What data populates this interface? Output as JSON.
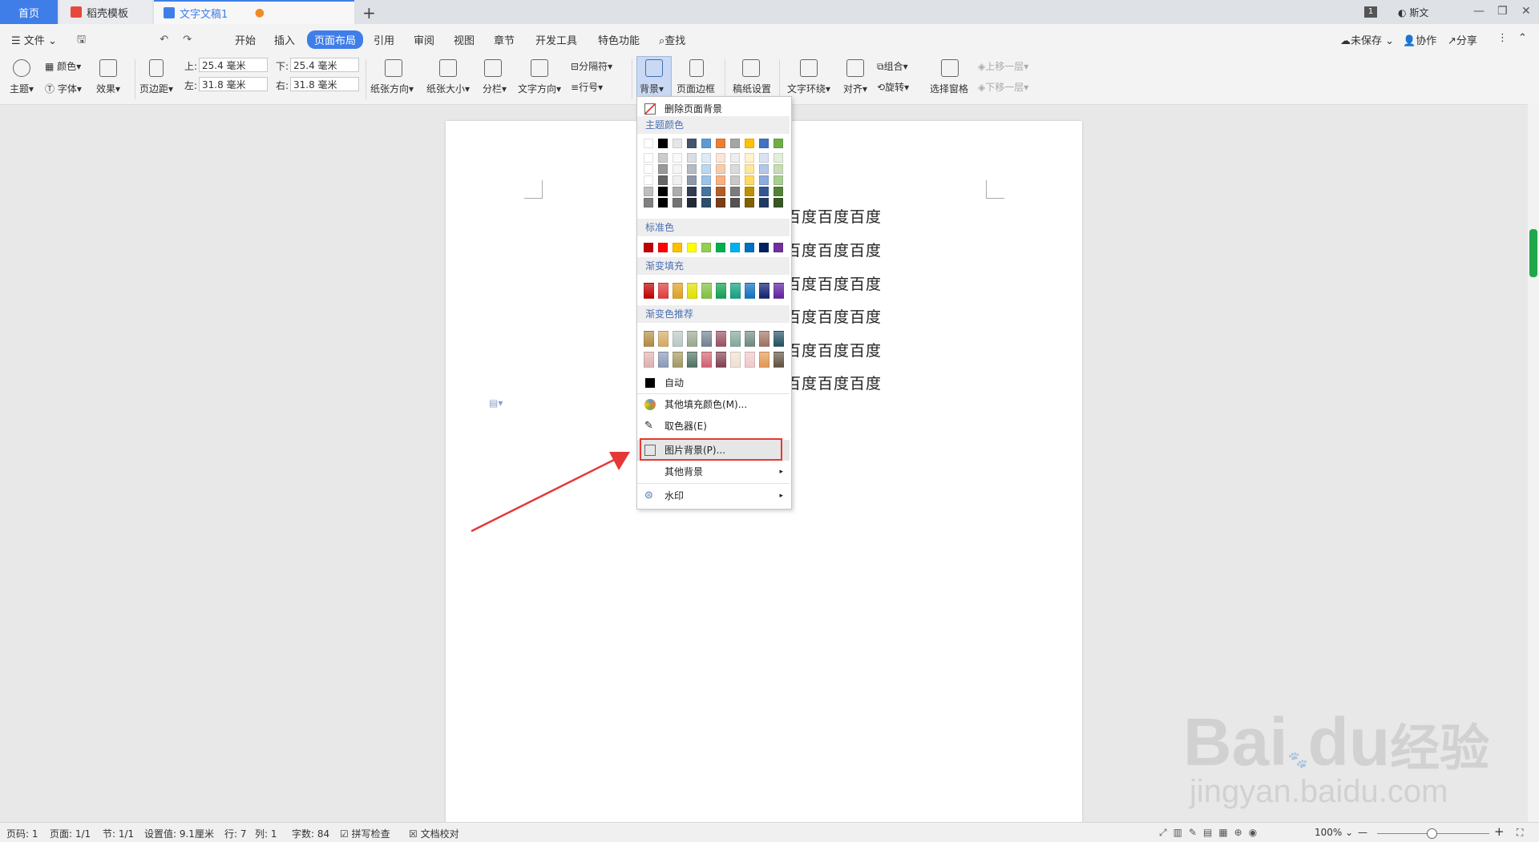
{
  "tabs": {
    "home": "首页",
    "daoke": "稻壳模板",
    "doc": "文字文稿1"
  },
  "window": {
    "page_badge": "1",
    "user": "斯文"
  },
  "menu": {
    "file": "文件",
    "items": [
      "开始",
      "插入",
      "页面布局",
      "引用",
      "审阅",
      "视图",
      "章节",
      "开发工具",
      "特色功能"
    ],
    "search": "查找",
    "unsaved": "未保存",
    "collab": "协作",
    "share": "分享"
  },
  "ribbon": {
    "theme": "主题",
    "color": "颜色",
    "font": "字体",
    "effect": "效果",
    "margins": "页边距",
    "top_label": "上:",
    "top_value": "25.4 毫米",
    "bottom_label": "下:",
    "bottom_value": "25.4 毫米",
    "left_label": "左:",
    "left_value": "31.8 毫米",
    "right_label": "右:",
    "right_value": "31.8 毫米",
    "orientation": "纸张方向",
    "size": "纸张大小",
    "columns": "分栏",
    "text_dir": "文字方向",
    "breaks": "分隔符",
    "line_num": "行号",
    "background": "背景",
    "border": "页面边框",
    "manuscript": "稿纸设置",
    "wrap": "文字环绕",
    "align": "对齐",
    "group": "组合",
    "rotate": "旋转",
    "select_pane": "选择窗格",
    "bring_forward": "上移一层",
    "send_backward": "下移一层"
  },
  "document": {
    "lines": [
      "百度百度百度",
      "百度百度百度",
      "百度百度百度",
      "百度百度百度",
      "百度百度百度",
      "百度百度百度"
    ]
  },
  "dropdown": {
    "remove_bg": "删除页面背景",
    "theme_colors": "主题颜色",
    "standard_colors": "标准色",
    "gradient_fill": "渐变填充",
    "gradient_recommend": "渐变色推荐",
    "auto": "自动",
    "more_colors": "其他填充颜色(M)...",
    "eyedropper": "取色器(E)",
    "picture_bg": "图片背景(P)...",
    "other_bg": "其他背景",
    "watermark": "水印",
    "theme_row": [
      "#ffffff",
      "#000000",
      "#e7e6e6",
      "#44546a",
      "#5b9bd5",
      "#ed7d31",
      "#a5a5a5",
      "#ffc000",
      "#4472c4",
      "#70ad47"
    ],
    "standard_row": [
      "#c00000",
      "#ff0000",
      "#ffc000",
      "#ffff00",
      "#92d050",
      "#00b050",
      "#00b0f0",
      "#0070c0",
      "#002060",
      "#7030a0"
    ],
    "gradient_row": [
      "#c00000",
      "#e03a3a",
      "#e0a020",
      "#e0e000",
      "#80c040",
      "#10a050",
      "#10a080",
      "#1070c0",
      "#102070",
      "#6020a0"
    ],
    "recommend_row1": [
      "#b08a40",
      "#d4a860",
      "#b8c8c8",
      "#98a890",
      "#708090",
      "#985060",
      "#80a898",
      "#708880",
      "#a07060",
      "#205060"
    ],
    "recommend_row2": [
      "#e0b0b0",
      "#8898b8",
      "#a09860",
      "#507060",
      "#d06070",
      "#804050",
      "#f0e0d0",
      "#f0c8c8",
      "#e09850",
      "#605040"
    ]
  },
  "status": {
    "page_num": "页码: 1",
    "pages": "页面: 1/1",
    "section": "节: 1/1",
    "setting": "设置值: 9.1厘米",
    "row": "行: 7",
    "col": "列: 1",
    "words": "字数: 84",
    "spell": "拼写检查",
    "proof": "文档校对",
    "zoom": "100%"
  },
  "watermark": {
    "brand": "Bai",
    "du": "du",
    "jy": "经验",
    "url": "jingyan.baidu.com"
  },
  "colors": {
    "accent": "#3f7ee8",
    "highlight": "#e53935",
    "arrow": "#e53935"
  }
}
